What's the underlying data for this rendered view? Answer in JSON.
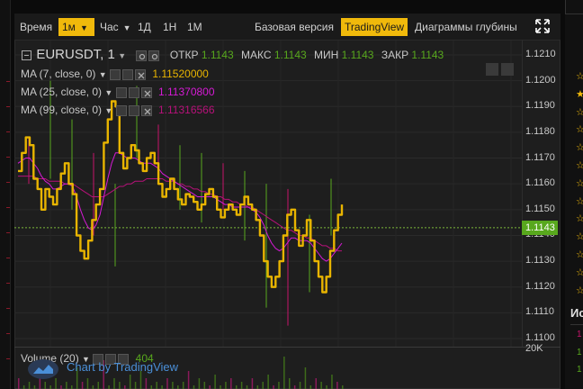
{
  "toolbar": {
    "time_label": "Время",
    "interval_selected": "1м",
    "hour_label": "Час",
    "intervals": [
      "1Д",
      "1Н",
      "1М"
    ],
    "basic_version": "Базовая версия",
    "tradingview": "TradingView",
    "depth_charts": "Диаграммы глубины"
  },
  "legend": {
    "symbol": "EURUSDT, 1",
    "open_label": "ОТКР",
    "open_value": "1.1143",
    "high_label": "МАКС",
    "high_value": "1.1143",
    "low_label": "МИН",
    "low_value": "1.1143",
    "close_label": "ЗАКР",
    "close_value": "1.1143",
    "ma7_label": "MA (7, close, 0)",
    "ma7_value": "1.11520000",
    "ma25_label": "MA (25, close, 0)",
    "ma25_value": "1.11370800",
    "ma99_label": "MA (99, close, 0)",
    "ma99_value": "1.11316566",
    "volume_label": "Volume (20)",
    "volume_value": "404"
  },
  "colors": {
    "up": "#58a81d",
    "down": "#c5146b",
    "ma7": "#e8b400",
    "ma25": "#d61ad6",
    "ma99": "#b8117a",
    "accent": "#f0b90b",
    "link": "#4a8fd8"
  },
  "price_axis": {
    "ticks": [
      "1.1210",
      "1.1200",
      "1.1190",
      "1.1180",
      "1.1170",
      "1.1160",
      "1.1150",
      "1.1140",
      "1.1130",
      "1.1120",
      "1.1110",
      "1.1100"
    ],
    "current_price": "1.1143",
    "volume_scale": "20K"
  },
  "right_panel": {
    "label": "Ис",
    "numbers": [
      "1",
      "1",
      "1"
    ]
  },
  "credit": "Chart by TradingView",
  "chart_data": {
    "type": "line",
    "series": [
      {
        "name": "MA (7, close, 0)",
        "values": [
          1.1165,
          1.1172,
          1.1178,
          1.1175,
          1.1162,
          1.1158,
          1.115,
          1.1158,
          1.1155,
          1.1152,
          1.1158,
          1.1164,
          1.1168,
          1.116,
          1.1156,
          1.114,
          1.1134,
          1.1131,
          1.1138,
          1.1146,
          1.1152,
          1.1158,
          1.1176,
          1.1185,
          1.1192,
          1.119,
          1.1172,
          1.1166,
          1.117,
          1.1175,
          1.1173,
          1.1168,
          1.1165,
          1.117,
          1.1172,
          1.1168,
          1.116,
          1.1155,
          1.1158,
          1.1162,
          1.1158,
          1.1154,
          1.1152,
          1.1156,
          1.1155,
          1.1153,
          1.115,
          1.1152,
          1.1156,
          1.1158,
          1.1155,
          1.115,
          1.1147,
          1.115,
          1.1152,
          1.115,
          1.1148,
          1.1152,
          1.1155,
          1.1152,
          1.115,
          1.1146,
          1.114,
          1.113,
          1.1124,
          1.112,
          1.1124,
          1.113,
          1.114,
          1.1148,
          1.115,
          1.1142,
          1.1136,
          1.114,
          1.1146,
          1.1138,
          1.113,
          1.1124,
          1.1118,
          1.1124,
          1.1134,
          1.1142,
          1.1148,
          1.1152
        ]
      },
      {
        "name": "MA (25, close, 0)",
        "values": [
          1.1168,
          1.1169,
          1.117,
          1.117,
          1.1168,
          1.1166,
          1.1163,
          1.1161,
          1.116,
          1.1158,
          1.1158,
          1.1159,
          1.116,
          1.116,
          1.1159,
          1.1155,
          1.115,
          1.1146,
          1.1143,
          1.1142,
          1.1144,
          1.1148,
          1.1155,
          1.1162,
          1.1168,
          1.1172,
          1.1172,
          1.1171,
          1.117,
          1.117,
          1.117,
          1.1169,
          1.1168,
          1.1168,
          1.1168,
          1.1167,
          1.1166,
          1.1164,
          1.1163,
          1.1162,
          1.1161,
          1.116,
          1.1159,
          1.1158,
          1.1157,
          1.1156,
          1.1155,
          1.1155,
          1.1155,
          1.1155,
          1.1155,
          1.1154,
          1.1153,
          1.1152,
          1.1152,
          1.1151,
          1.1151,
          1.1151,
          1.1151,
          1.1151,
          1.115,
          1.1149,
          1.1147,
          1.1144,
          1.114,
          1.1137,
          1.1135,
          1.1134,
          1.1135,
          1.1137,
          1.1139,
          1.1139,
          1.1138,
          1.1138,
          1.1138,
          1.1137,
          1.1135,
          1.1133,
          1.1131,
          1.113,
          1.1131,
          1.1133,
          1.1135,
          1.1137
        ]
      },
      {
        "name": "MA (99, close, 0)",
        "values": [
          1.1163,
          1.1163,
          1.1163,
          1.1163,
          1.1163,
          1.1162,
          1.1162,
          1.1162,
          1.1161,
          1.1161,
          1.1161,
          1.1161,
          1.116,
          1.116,
          1.116,
          1.1159,
          1.1158,
          1.1157,
          1.1156,
          1.1155,
          1.1155,
          1.1155,
          1.1155,
          1.1156,
          1.1157,
          1.1158,
          1.1159,
          1.1159,
          1.116,
          1.116,
          1.1161,
          1.1161,
          1.1161,
          1.1162,
          1.1162,
          1.1162,
          1.1162,
          1.1162,
          1.1161,
          1.1161,
          1.1161,
          1.116,
          1.116,
          1.1159,
          1.1159,
          1.1158,
          1.1158,
          1.1157,
          1.1157,
          1.1156,
          1.1156,
          1.1155,
          1.1155,
          1.1154,
          1.1154,
          1.1153,
          1.1153,
          1.1152,
          1.1152,
          1.1151,
          1.1151,
          1.115,
          1.1149,
          1.1148,
          1.1147,
          1.1146,
          1.1145,
          1.1144,
          1.1143,
          1.1142,
          1.1142,
          1.1141,
          1.114,
          1.114,
          1.1139,
          1.1139,
          1.1138,
          1.1137,
          1.1136,
          1.1136,
          1.1135,
          1.1135,
          1.1134,
          1.1134
        ]
      }
    ],
    "spikes": [
      [
        1.1178,
        1.116
      ],
      [
        1.12,
        1.1162
      ],
      [
        1.1185,
        1.115
      ],
      [
        1.1172,
        1.114
      ],
      [
        1.116,
        1.1128
      ],
      [
        1.1198,
        1.117
      ],
      [
        1.1183,
        1.116
      ],
      [
        1.1175,
        1.115
      ],
      [
        1.1172,
        1.1145
      ],
      [
        1.1168,
        1.115
      ],
      [
        1.1165,
        1.1138
      ],
      [
        1.116,
        1.1112
      ],
      [
        1.1158,
        1.1105
      ],
      [
        1.1148,
        1.1118
      ],
      [
        1.1162,
        1.114
      ]
    ],
    "ylim": [
      1.11,
      1.121
    ],
    "volume": [
      0.3,
      0.1,
      0.2,
      0.1,
      0.4,
      0.2,
      0.1,
      0.3,
      0.1,
      0.2,
      0.1,
      0.6,
      0.2,
      0.3,
      0.1,
      0.2,
      0.8,
      0.1,
      0.3,
      0.2,
      0.1,
      0.4,
      0.2,
      0.5,
      0.3,
      0.1,
      0.2,
      0.1,
      0.3,
      0.2,
      0.1,
      0.2,
      0.5,
      0.1,
      0.3,
      0.2,
      0.1,
      0.4,
      0.1,
      0.2,
      0.3,
      0.1,
      0.2,
      0.1,
      0.3,
      0.1,
      0.2,
      0.4,
      0.1,
      0.2,
      0.9,
      0.3,
      0.1,
      0.2,
      0.6,
      0.1,
      0.3,
      0.2,
      0.1,
      0.4,
      0.2,
      0.1
    ]
  }
}
